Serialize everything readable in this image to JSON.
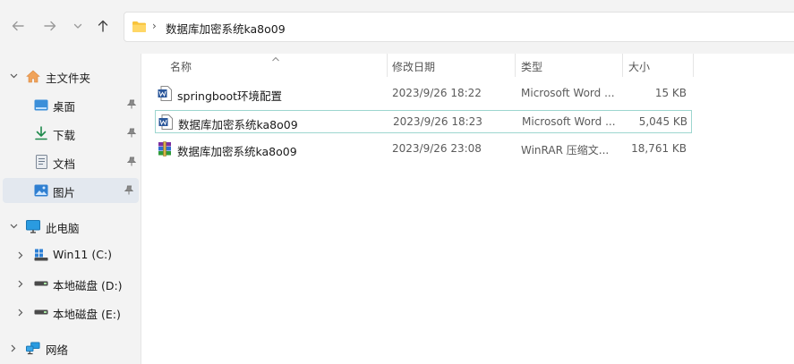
{
  "address_bar": {
    "path_segment": "数据库加密系统ka8o09",
    "icons": [
      "back-arrow-icon",
      "forward-arrow-icon",
      "recent-dropdown-icon",
      "up-arrow-icon",
      "folder-icon",
      "chevron-right-icon"
    ]
  },
  "sidebar": {
    "home": {
      "label": "主文件夹",
      "icon": "home-icon",
      "expanded": true
    },
    "quick_access": [
      {
        "label": "桌面",
        "icon": "desktop-icon",
        "pinned": true
      },
      {
        "label": "下载",
        "icon": "download-icon",
        "pinned": true
      },
      {
        "label": "文档",
        "icon": "document-icon",
        "pinned": true
      },
      {
        "label": "图片",
        "icon": "pictures-icon",
        "pinned": true,
        "selected": true
      }
    ],
    "this_pc": {
      "label": "此电脑",
      "icon": "monitor-icon",
      "expanded": true
    },
    "drives": [
      {
        "label": "Win11 (C:)",
        "icon": "windows-drive-icon"
      },
      {
        "label": "本地磁盘 (D:)",
        "icon": "drive-icon"
      },
      {
        "label": "本地磁盘 (E:)",
        "icon": "drive-icon"
      }
    ],
    "network": {
      "label": "网络",
      "icon": "network-icon"
    }
  },
  "columns": {
    "name": "名称",
    "date": "修改日期",
    "type": "类型",
    "size": "大小"
  },
  "files": [
    {
      "name": "springboot环境配置",
      "date": "2023/9/26 18:22",
      "type": "Microsoft Word ...",
      "size": "15 KB",
      "icon": "word-doc-icon"
    },
    {
      "name": "数据库加密系统ka8o09",
      "date": "2023/9/26 18:23",
      "type": "Microsoft Word ...",
      "size": "5,045 KB",
      "icon": "word-doc-icon"
    },
    {
      "name": "数据库加密系统ka8o09",
      "date": "2023/9/26 23:08",
      "type": "WinRAR 压缩文...",
      "size": "18,761 KB",
      "icon": "winrar-archive-icon"
    }
  ],
  "colors": {
    "chrome_bg": "#f3f3f3",
    "selection_bg": "#e3e8ef",
    "focus_border": "#9dd6cf",
    "word_blue": "#2b579a",
    "folder_yellow": "#f8c33a"
  }
}
